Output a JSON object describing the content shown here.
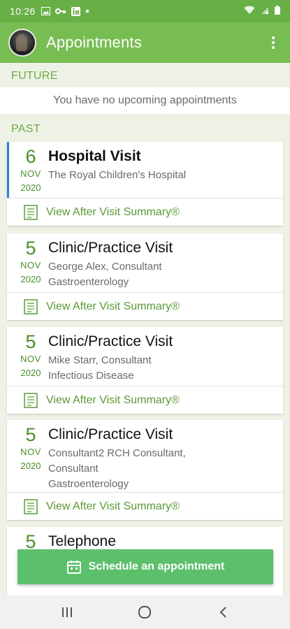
{
  "status_bar": {
    "time": "10:26",
    "icons_left": [
      "image-icon",
      "key-icon",
      "linkedin-icon",
      "dot-icon"
    ],
    "icons_right": [
      "wifi-icon",
      "signal-icon",
      "battery-icon"
    ]
  },
  "app_bar": {
    "title": "Appointments",
    "menu_icon": "more-vert-icon"
  },
  "sections": {
    "future_label": "FUTURE",
    "future_empty": "You have no upcoming appointments",
    "past_label": "PAST"
  },
  "appointments": [
    {
      "day": "6",
      "month": "NOV",
      "year": "2020",
      "type": "Hospital Visit",
      "line1": "The Royal Children's Hospital",
      "line2": "",
      "summary": "View After Visit Summary®"
    },
    {
      "day": "5",
      "month": "NOV",
      "year": "2020",
      "type": "Clinic/Practice Visit",
      "line1": "George Alex, Consultant",
      "line2": "Gastroenterology",
      "summary": "View After Visit Summary®"
    },
    {
      "day": "5",
      "month": "NOV",
      "year": "2020",
      "type": "Clinic/Practice Visit",
      "line1": "Mike Starr, Consultant",
      "line2": "Infectious Disease",
      "summary": "View After Visit Summary®"
    },
    {
      "day": "5",
      "month": "NOV",
      "year": "2020",
      "type": "Clinic/Practice Visit",
      "line1": "Consultant2 RCH Consultant,",
      "line1b": "Consultant",
      "line2": "Gastroenterology",
      "summary": "View After Visit Summary®"
    },
    {
      "day": "5",
      "type": "Telephone"
    }
  ],
  "schedule_button": {
    "label": "Schedule an appointment",
    "icon": "calendar-icon"
  },
  "colors": {
    "status_bar": "#68b045",
    "app_bar": "#78bd52",
    "accent_green": "#5a9a35",
    "button_green": "#5cbf6a",
    "active_marker": "#2a7de1"
  }
}
